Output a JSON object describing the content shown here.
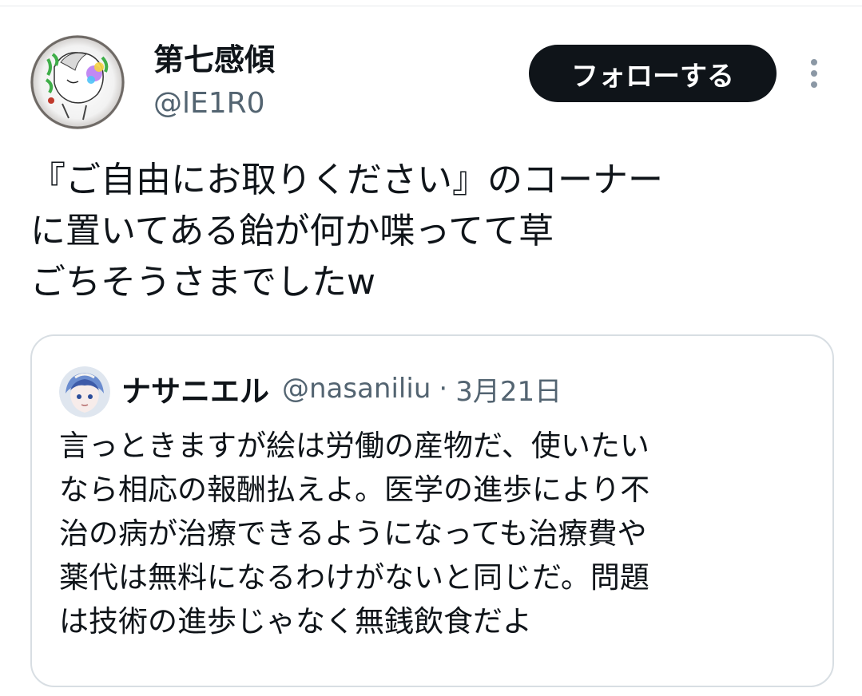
{
  "author": {
    "display_name": "第七感傾",
    "handle": "@lE1R0",
    "avatar_icon": "profile-avatar"
  },
  "follow_button": {
    "label": "フォローする",
    "background": "#0f1419"
  },
  "more_icon": "more-vertical-icon",
  "tweet": {
    "lines": [
      "『ご自由にお取りください』のコーナー",
      "に置いてある飴が何か喋ってて草",
      "ごちそうさまでしたw"
    ]
  },
  "quoted_tweet": {
    "display_name": "ナサニエル",
    "handle": "@nasaniliu",
    "separator": "·",
    "date": "3月21日",
    "lines": [
      "言っときますが絵は労働の産物だ、使いたい",
      "なら相応の報酬払えよ。医学の進歩により不",
      "治の病が治療できるようになっても治療費や",
      "薬代は無料になるわけがないと同じだ。問題",
      "は技術の進歩じゃなく無銭飲食だよ"
    ]
  },
  "colors": {
    "text_primary": "#0f1419",
    "text_secondary": "#536471",
    "card_border": "#d8dee3"
  }
}
